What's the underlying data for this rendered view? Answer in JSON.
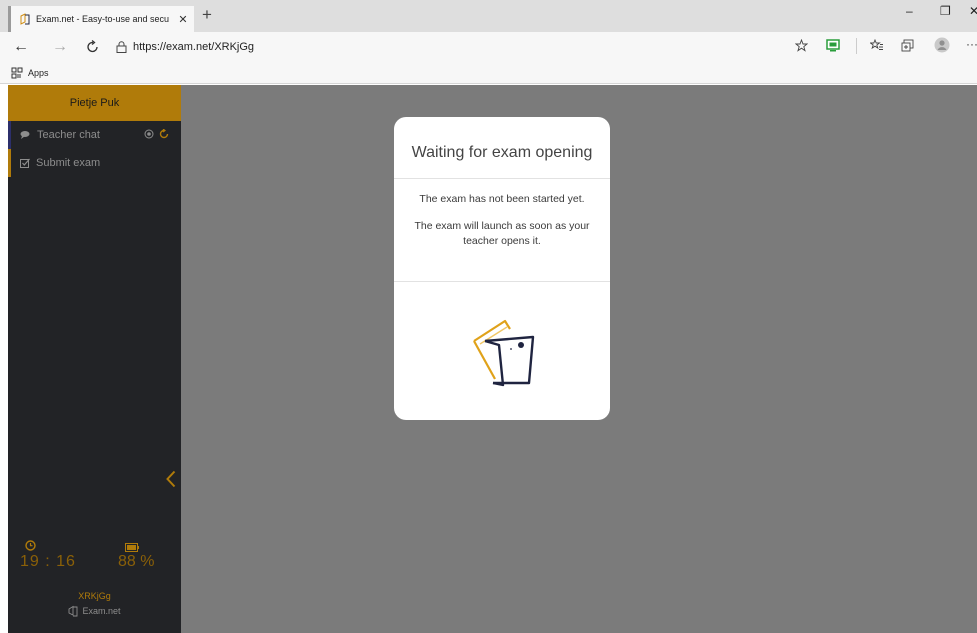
{
  "browser": {
    "tab_title": "Exam.net - Easy-to-use and secu",
    "tab_close": "✕",
    "new_tab": "+",
    "url": "https://exam.net/XRKjGg",
    "bookmarks_apps": "Apps",
    "win_min": "–",
    "win_max": "❐",
    "win_close": "✕"
  },
  "sidebar": {
    "user_name": "Pietje Puk",
    "items": [
      {
        "label": "Teacher chat",
        "icon": "chat-icon"
      },
      {
        "label": "Submit exam",
        "icon": "checkbox-icon"
      }
    ],
    "time": "19 : 16",
    "battery": "88 %",
    "exam_code": "XRKjGg",
    "brand": "Exam.net"
  },
  "dialog": {
    "title": "Waiting for exam opening",
    "line1": "The exam has not been started yet.",
    "line2": "The exam will launch as soon as your teacher opens it."
  },
  "colors": {
    "accent": "#b07b0a",
    "sidebar_bg": "#222326",
    "overlay_bg": "#7b7b7b",
    "navy": "#1f2440"
  }
}
